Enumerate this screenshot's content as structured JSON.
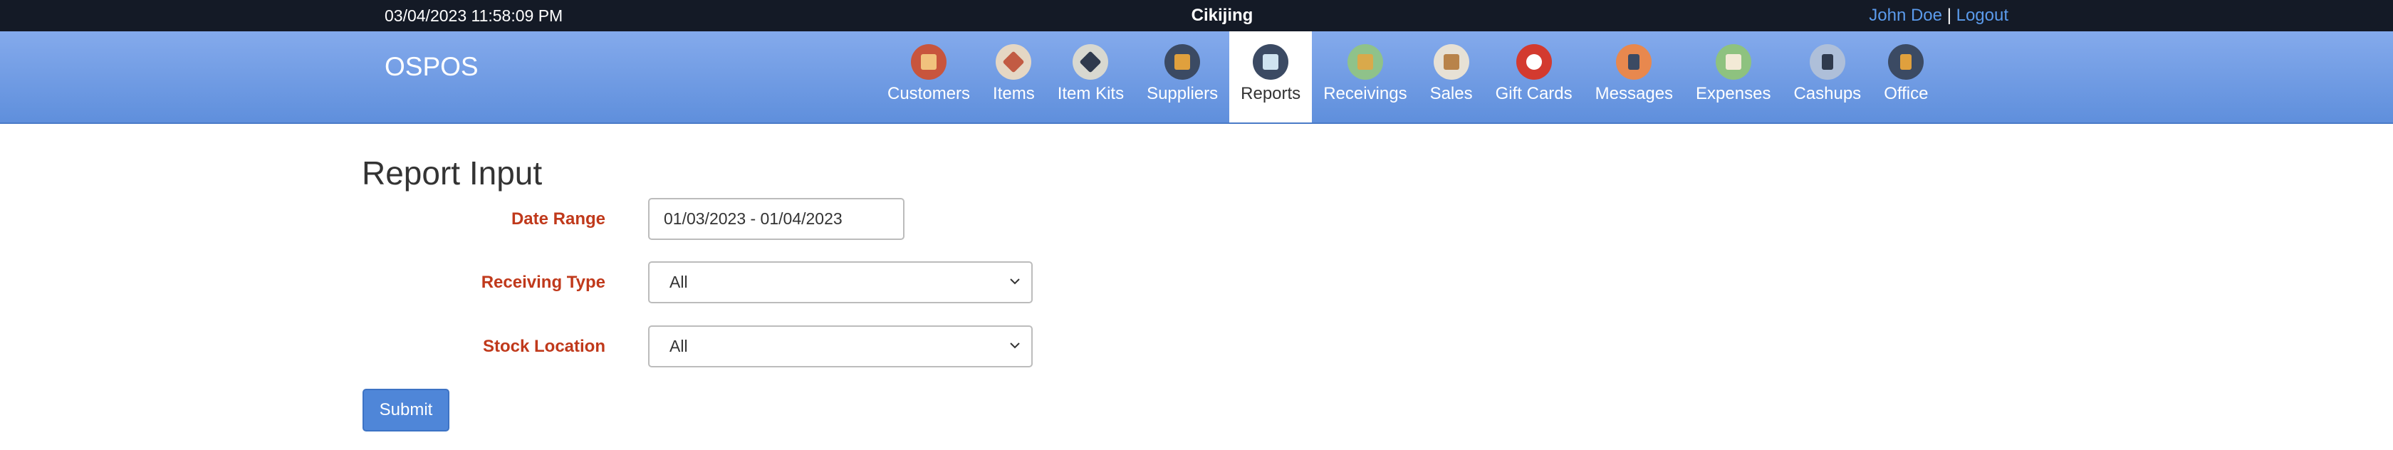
{
  "topbar": {
    "datetime": "03/04/2023 11:58:09 PM",
    "company": "Cikijing",
    "user_name": "John Doe",
    "separator": "|",
    "logout_label": "Logout"
  },
  "navbar": {
    "brand": "OSPOS",
    "items": [
      {
        "label": "Customers",
        "icon": "customers-icon",
        "color": "#c8553d"
      },
      {
        "label": "Items",
        "icon": "items-icon",
        "color": "#e5d7c4"
      },
      {
        "label": "Item Kits",
        "icon": "item-kits-icon",
        "color": "#d8d8d0"
      },
      {
        "label": "Suppliers",
        "icon": "suppliers-icon",
        "color": "#3b4a63"
      },
      {
        "label": "Reports",
        "icon": "reports-icon",
        "color": "#3b4a63"
      },
      {
        "label": "Receivings",
        "icon": "receivings-icon",
        "color": "#8fc28a"
      },
      {
        "label": "Sales",
        "icon": "sales-icon",
        "color": "#e7e1d5"
      },
      {
        "label": "Gift Cards",
        "icon": "gift-cards-icon",
        "color": "#d33a2f"
      },
      {
        "label": "Messages",
        "icon": "messages-icon",
        "color": "#e8884e"
      },
      {
        "label": "Expenses",
        "icon": "expenses-icon",
        "color": "#8ec27f"
      },
      {
        "label": "Cashups",
        "icon": "cashups-icon",
        "color": "#aebfd9"
      },
      {
        "label": "Office",
        "icon": "office-icon",
        "color": "#3b4a63"
      }
    ],
    "active": "Reports"
  },
  "form": {
    "title": "Report Input",
    "date_range_label": "Date Range",
    "date_range_value": "01/03/2023 - 01/04/2023",
    "receiving_type_label": "Receiving Type",
    "receiving_type_value": "All",
    "stock_location_label": "Stock Location",
    "stock_location_value": "All",
    "submit_label": "Submit"
  },
  "colors": {
    "topbar_bg": "#141a26",
    "nav_gradient_top": "#84aaec",
    "nav_gradient_bottom": "#5f8fdc",
    "label_red": "#c0391b",
    "submit_blue": "#4f86d8",
    "link_blue": "#5b9bec"
  }
}
